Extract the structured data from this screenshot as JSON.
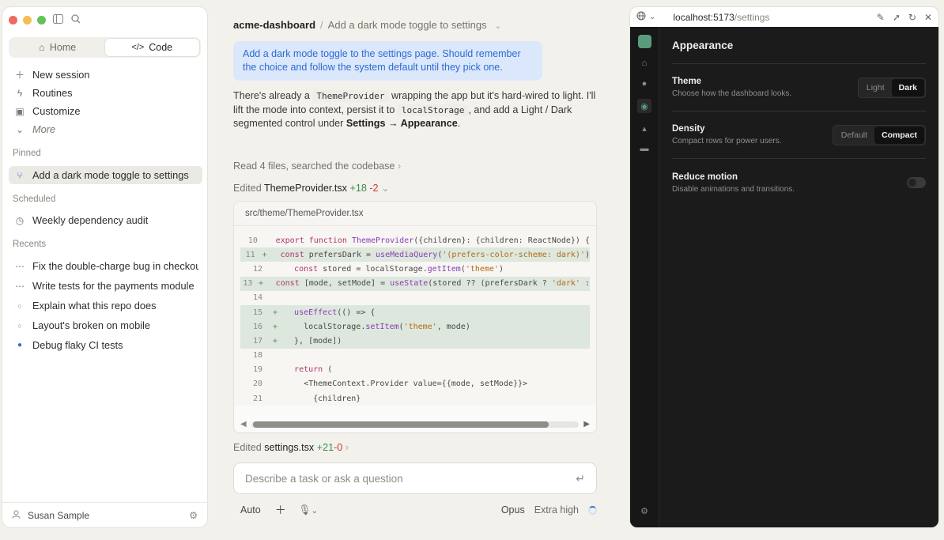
{
  "sidebar": {
    "tabs": [
      {
        "label": "Home",
        "icon": "home-icon"
      },
      {
        "label": "Code",
        "icon": "code-icon",
        "active": true
      }
    ],
    "actions": [
      {
        "label": "New session",
        "icon": "plus-icon"
      },
      {
        "label": "Routines",
        "icon": "routines-icon"
      },
      {
        "label": "Customize",
        "icon": "customize-icon"
      },
      {
        "label": "More",
        "icon": "chevron-down-icon"
      }
    ],
    "pinned_label": "Pinned",
    "pinned": [
      {
        "label": "Add a dark mode toggle to settings",
        "icon": "branch-icon"
      }
    ],
    "scheduled_label": "Scheduled",
    "scheduled": [
      {
        "label": "Weekly dependency audit",
        "icon": "clock-icon"
      }
    ],
    "recents_label": "Recents",
    "recents": [
      {
        "label": "Fix the double-charge bug in checkout",
        "icon": "dots-icon"
      },
      {
        "label": "Write tests for the payments module",
        "icon": "dots-icon"
      },
      {
        "label": "Explain what this repo does",
        "icon": "circle-icon"
      },
      {
        "label": "Layout's broken on mobile",
        "icon": "circle-icon"
      },
      {
        "label": "Debug flaky CI tests",
        "icon": "blue-dot-icon"
      }
    ],
    "user": "Susan Sample"
  },
  "main": {
    "project": "acme-dashboard",
    "task": "Add a dark mode toggle to settings",
    "user_message": "Add a dark mode toggle to the settings page. Should remember the choice and follow the system default until they pick one.",
    "reply": {
      "p1": "There's already a ",
      "code1": "ThemeProvider",
      "p2": " wrapping the app but it's hard-wired to light. I'll lift the mode into context, persist it to ",
      "code2": "localStorage",
      "p3": ", and add a Light / Dark segmented control under ",
      "bold": "Settings → Appearance",
      "p4": "."
    },
    "read_step": "Read 4 files, searched the codebase",
    "edit1": {
      "prefix": "Edited ",
      "file": "ThemeProvider.tsx",
      "add": "+18",
      "del": "-2"
    },
    "diff_path": "src/theme/ThemeProvider.tsx",
    "edit2": {
      "prefix": "Edited ",
      "file": "settings.tsx",
      "add": "+21",
      "del": "-0"
    },
    "composer_placeholder": "Describe a task or ask a question",
    "toolbar": {
      "mode": "Auto",
      "model": "Opus",
      "effort": "Extra high"
    }
  },
  "browser": {
    "host": "localhost:5173",
    "path": "/settings",
    "title": "Appearance",
    "settings": [
      {
        "title": "Theme",
        "desc": "Choose how the dashboard looks.",
        "options": [
          "Light",
          "Dark"
        ],
        "selected": "Dark"
      },
      {
        "title": "Density",
        "desc": "Compact rows for power users.",
        "options": [
          "Default",
          "Compact"
        ],
        "selected": "Compact"
      },
      {
        "title": "Reduce motion",
        "desc": "Disable animations and transitions.",
        "toggle": false
      }
    ]
  },
  "colors": {
    "accent": "#2f6fd0",
    "brand": "#5a9b7e",
    "added_bg": "#dde7dd"
  }
}
